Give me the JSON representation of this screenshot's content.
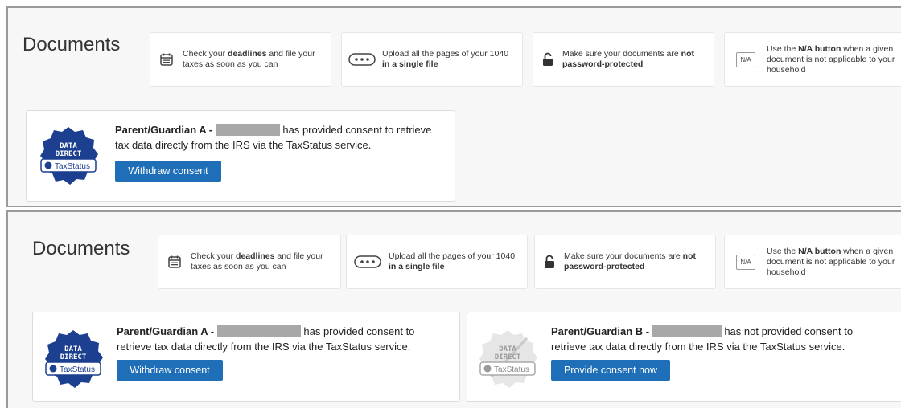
{
  "page_title": "Documents",
  "tips": [
    {
      "icon": "calendar-icon",
      "pre": "Check your ",
      "bold": "deadlines",
      "post": " and file your taxes as soon as you can"
    },
    {
      "icon": "ellipsis-icon",
      "pre": "Upload all the pages of your 1040 ",
      "bold": "in a single file",
      "post": ""
    },
    {
      "icon": "lock-icon",
      "pre": "Make sure your documents are ",
      "bold": "not",
      "bold2": "password-protected"
    },
    {
      "icon": "na-icon",
      "icon_text": "N/A",
      "pre": "Use the ",
      "bold": "N/A button",
      "post": " when a given document is not applicable to your household"
    }
  ],
  "badge": {
    "line1": "DATA",
    "line2": "DIRECT",
    "brand": "TaxStatus"
  },
  "guardian_a": {
    "label": "Parent/Guardian A -",
    "status": "has provided consent to",
    "status_top": "has provided consent to retrieve",
    "line2_top": "tax data directly from the IRS via the TaxStatus service.",
    "line2_bottom": "retrieve tax data directly from the IRS via the TaxStatus service.",
    "button": "Withdraw consent"
  },
  "guardian_b": {
    "label": "Parent/Guardian B -",
    "status": "has not provided consent to",
    "line2": "retrieve tax data directly from the IRS via the TaxStatus service.",
    "button": "Provide consent now"
  }
}
